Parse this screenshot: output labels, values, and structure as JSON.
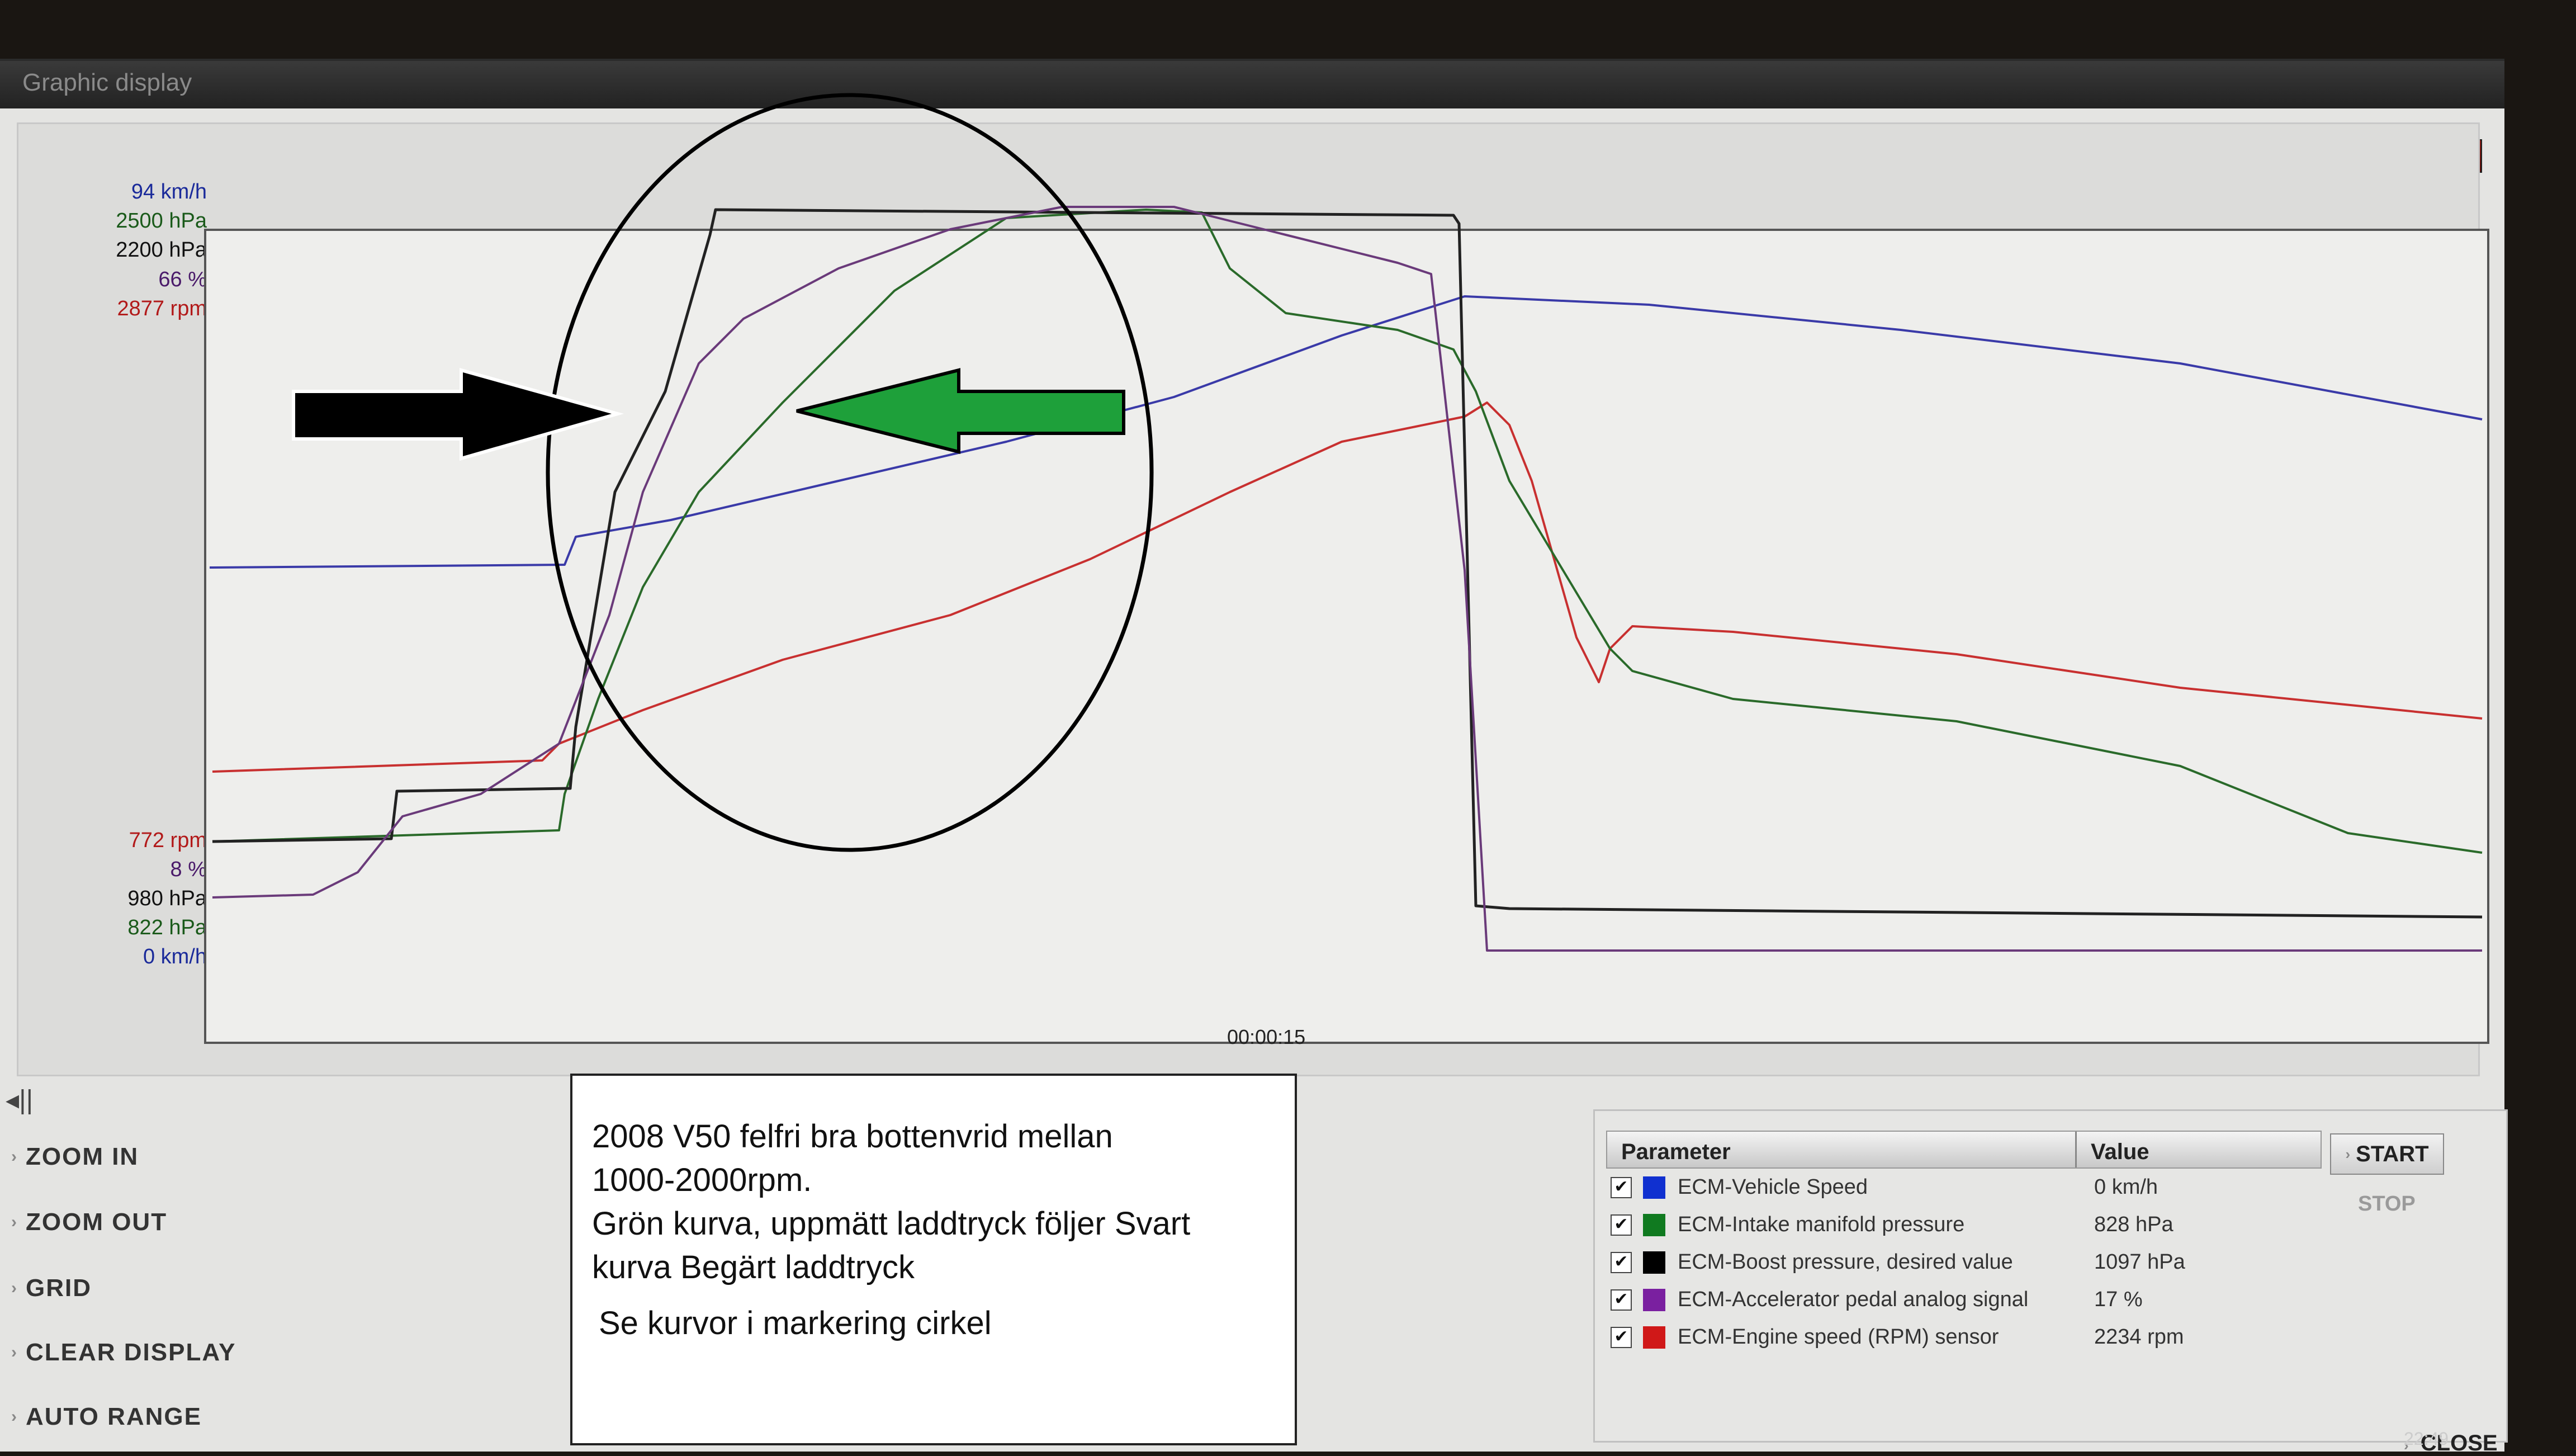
{
  "window": {
    "title": "Graphic display",
    "minimize": "–",
    "restore": "▢",
    "close": "✕"
  },
  "axis_labels": {
    "top": [
      {
        "text": "94 km/h",
        "color": "#1a2a9a"
      },
      {
        "text": "2500 hPa",
        "color": "#1a5a1a"
      },
      {
        "text": "2200 hPa",
        "color": "#111111"
      },
      {
        "text": "66 %",
        "color": "#4a1a6a"
      },
      {
        "text": "2877 rpm",
        "color": "#b21a1a"
      }
    ],
    "bottom": [
      {
        "text": "772 rpm",
        "color": "#b21a1a"
      },
      {
        "text": "8 %",
        "color": "#4a1a6a"
      },
      {
        "text": "980 hPa",
        "color": "#111111"
      },
      {
        "text": "822 hPa",
        "color": "#1a5a1a"
      },
      {
        "text": "0 km/h",
        "color": "#1a2a9a"
      }
    ]
  },
  "time_label": "00:00:15",
  "side_buttons": [
    "ZOOM IN",
    "ZOOM OUT",
    "GRID",
    "CLEAR DISPLAY",
    "AUTO RANGE"
  ],
  "note": {
    "line1": "2008 V50 felfri bra bottenvrid mellan",
    "line2": "1000-2000rpm.",
    "line3": "Grön kurva, uppmätt laddtryck följer Svart",
    "line4": "kurva Begärt laddtryck",
    "line5": "Se kurvor i markering cirkel"
  },
  "param_table": {
    "header_parameter": "Parameter",
    "header_value": "Value",
    "rows": [
      {
        "name": "ECM-Vehicle Speed",
        "value": "0 km/h",
        "color": "#1030d0",
        "checked": "✔"
      },
      {
        "name": "ECM-Intake manifold pressure",
        "value": "828 hPa",
        "color": "#107a20",
        "checked": "✔"
      },
      {
        "name": "ECM-Boost pressure, desired value",
        "value": "1097 hPa",
        "color": "#000000",
        "checked": "✔"
      },
      {
        "name": "ECM-Accelerator pedal analog signal",
        "value": "17 %",
        "color": "#7a20a0",
        "checked": "✔"
      },
      {
        "name": "ECM-Engine speed (RPM) sensor",
        "value": "2234 rpm",
        "color": "#d01818",
        "checked": "✔"
      }
    ]
  },
  "start_label": "START",
  "stop_label": "STOP",
  "close_label": "CLOSE",
  "clock": "22:49",
  "series_colors": {
    "speed": "#3a3aa8",
    "intake": "#2a6a2a",
    "boost": "#222222",
    "pedal": "#6a3a7a",
    "rpm": "#c83030"
  }
}
